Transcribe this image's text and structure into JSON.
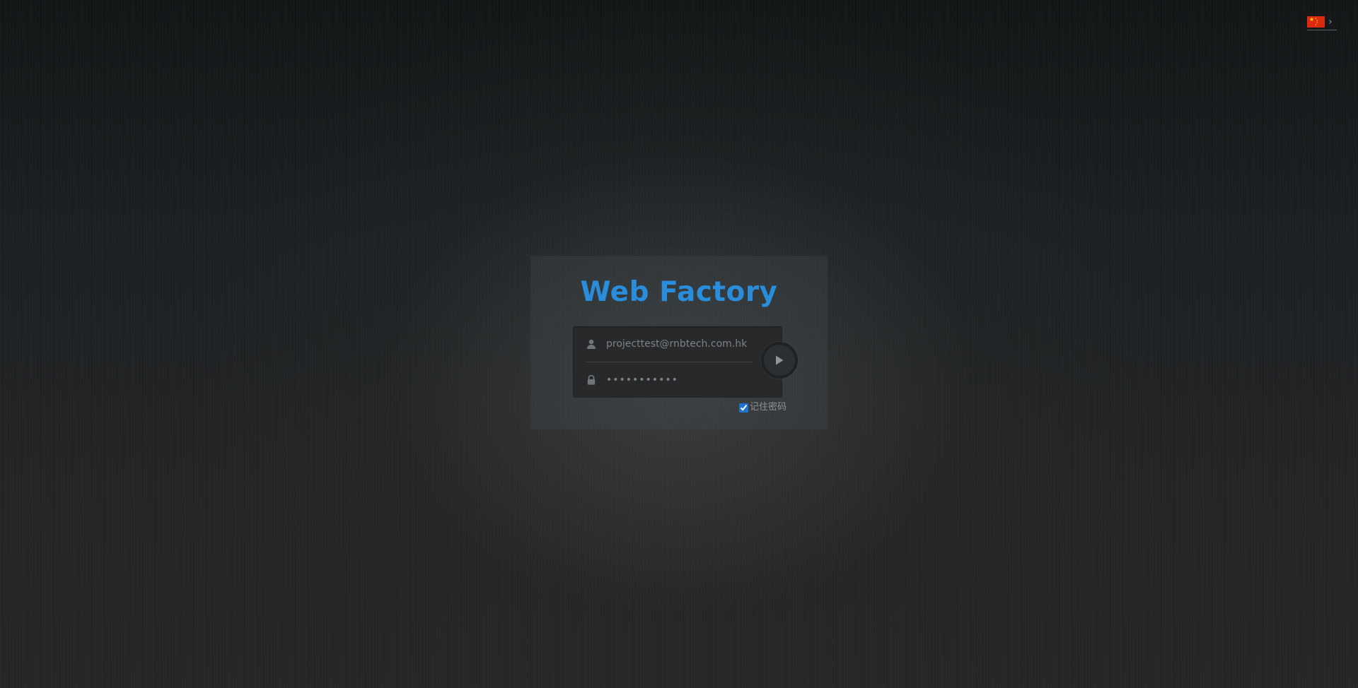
{
  "language_switcher": {
    "flag": "china-flag-icon",
    "chevron": "chevron-right-icon",
    "chevron_glyph": "›"
  },
  "login": {
    "title": "Web Factory",
    "username": {
      "icon": "user-icon",
      "value": "projecttest@rnbtech.com.hk"
    },
    "password": {
      "icon": "lock-icon",
      "value": "•••••••••••"
    },
    "submit": {
      "icon": "play-arrow-icon"
    },
    "remember": {
      "checked": true,
      "label": "记住密码"
    }
  },
  "colors": {
    "title": "#2a8ddb",
    "checkbox_accent": "#1e74d0",
    "flag_red": "#de2910",
    "flag_star": "#ffde00"
  }
}
